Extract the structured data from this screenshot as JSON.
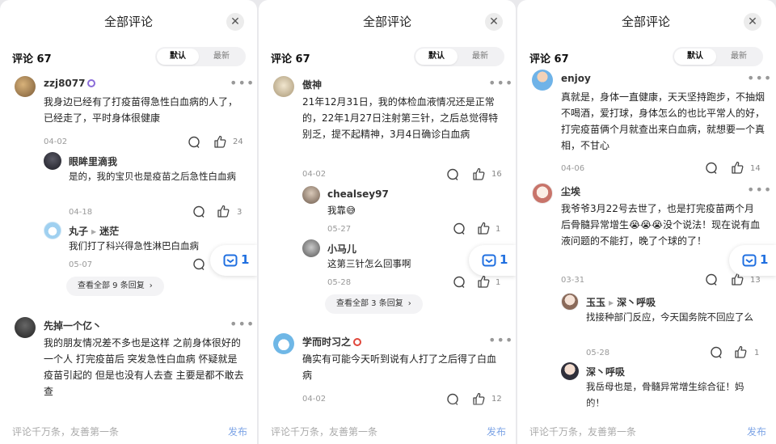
{
  "panels": [
    {
      "title": "全部评论",
      "count": "评论 67",
      "sort": {
        "default": "默认",
        "latest": "最新"
      },
      "float_count": "1",
      "footer": {
        "placeholder": "评论千万条，友善第一条",
        "send": "发布"
      },
      "comments": [
        {
          "name": "zzj8077",
          "text": "我身边已经有了打疫苗得急性白血病的人了，已经走了，平时身体很健康",
          "date": "04-02",
          "likes": "24"
        },
        {
          "name": "眼眸里滴我",
          "text": "是的，我的宝贝也是疫苗之后急性白血病",
          "date": "04-18",
          "likes": "3"
        },
        {
          "name": "丸子",
          "reply_to": "迷茫",
          "text": "我们打了科兴得急性淋巴白血病",
          "date": "05-07",
          "likes": ""
        },
        {
          "name": "先掉一个亿丶",
          "text": "我的朋友情况差不多也是这样 之前身体很好的一个人 打完疫苗后 突发急性白血病 怀疑就是疫苗引起的 但是也没有人去查 主要是都不敢去查",
          "date": "",
          "likes": ""
        }
      ],
      "view_replies": "查看全部 9 条回复"
    },
    {
      "title": "全部评论",
      "count": "评论 67",
      "sort": {
        "default": "默认",
        "latest": "最新"
      },
      "float_count": "1",
      "footer": {
        "placeholder": "评论千万条，友善第一条",
        "send": "发布"
      },
      "comments": [
        {
          "name": "傲神",
          "text": "21年12月31日，我的体检血液情况还是正常的，22年1月27日注射第三针，之后总觉得特别乏，提不起精神，3月4日确诊白血病",
          "date": "04-02",
          "likes": "16"
        },
        {
          "name": "chealsey97",
          "text": "我靠😅",
          "date": "05-27",
          "likes": "1"
        },
        {
          "name": "小马儿",
          "text": "这第三针怎么回事啊",
          "date": "05-28",
          "likes": "1"
        },
        {
          "name": "学而时习之",
          "text": "确实有可能今天听到说有人打了之后得了白血病",
          "date": "04-02",
          "likes": "12"
        }
      ],
      "view_replies": "查看全部 3 条回复"
    },
    {
      "title": "全部评论",
      "count": "评论 67",
      "sort": {
        "default": "默认",
        "latest": "最新"
      },
      "float_count": "1",
      "footer": {
        "placeholder": "评论千万条，友善第一条",
        "send": "发布"
      },
      "comments": [
        {
          "name": "enjoy",
          "text": "真就是，身体一直健康，天天坚持跑步，不抽烟不喝酒，爱打球，身体怎么的也比平常人的好，打完疫苗俩个月就查出来白血病，就想要一个真相，不甘心",
          "date": "04-06",
          "likes": "14"
        },
        {
          "name": "尘埃",
          "text": "我爷爷3月22号去世了，也是打完疫苗两个月后骨髓异常增生😭😭😭没个说法！现在说有血液问题的不能打，晚了个球的了！",
          "date": "03-31",
          "likes": "13"
        },
        {
          "name": "玉玉",
          "reply_to": "深丶呼吸",
          "text": "找接种部门反应，今天国务院不回应了么",
          "date": "05-28",
          "likes": "1"
        },
        {
          "name": "深丶呼吸",
          "text": "我岳母也是，骨髓异常增生综合征！妈的！",
          "date": "",
          "likes": ""
        }
      ]
    }
  ],
  "icons": {
    "close": "close-icon",
    "comment": "comment-icon",
    "like": "thumbs-up-icon",
    "more": "more-icon",
    "chat": "chat-box-icon"
  },
  "colors": {
    "accent": "#1f6fe0",
    "send": "#7da4e6"
  }
}
